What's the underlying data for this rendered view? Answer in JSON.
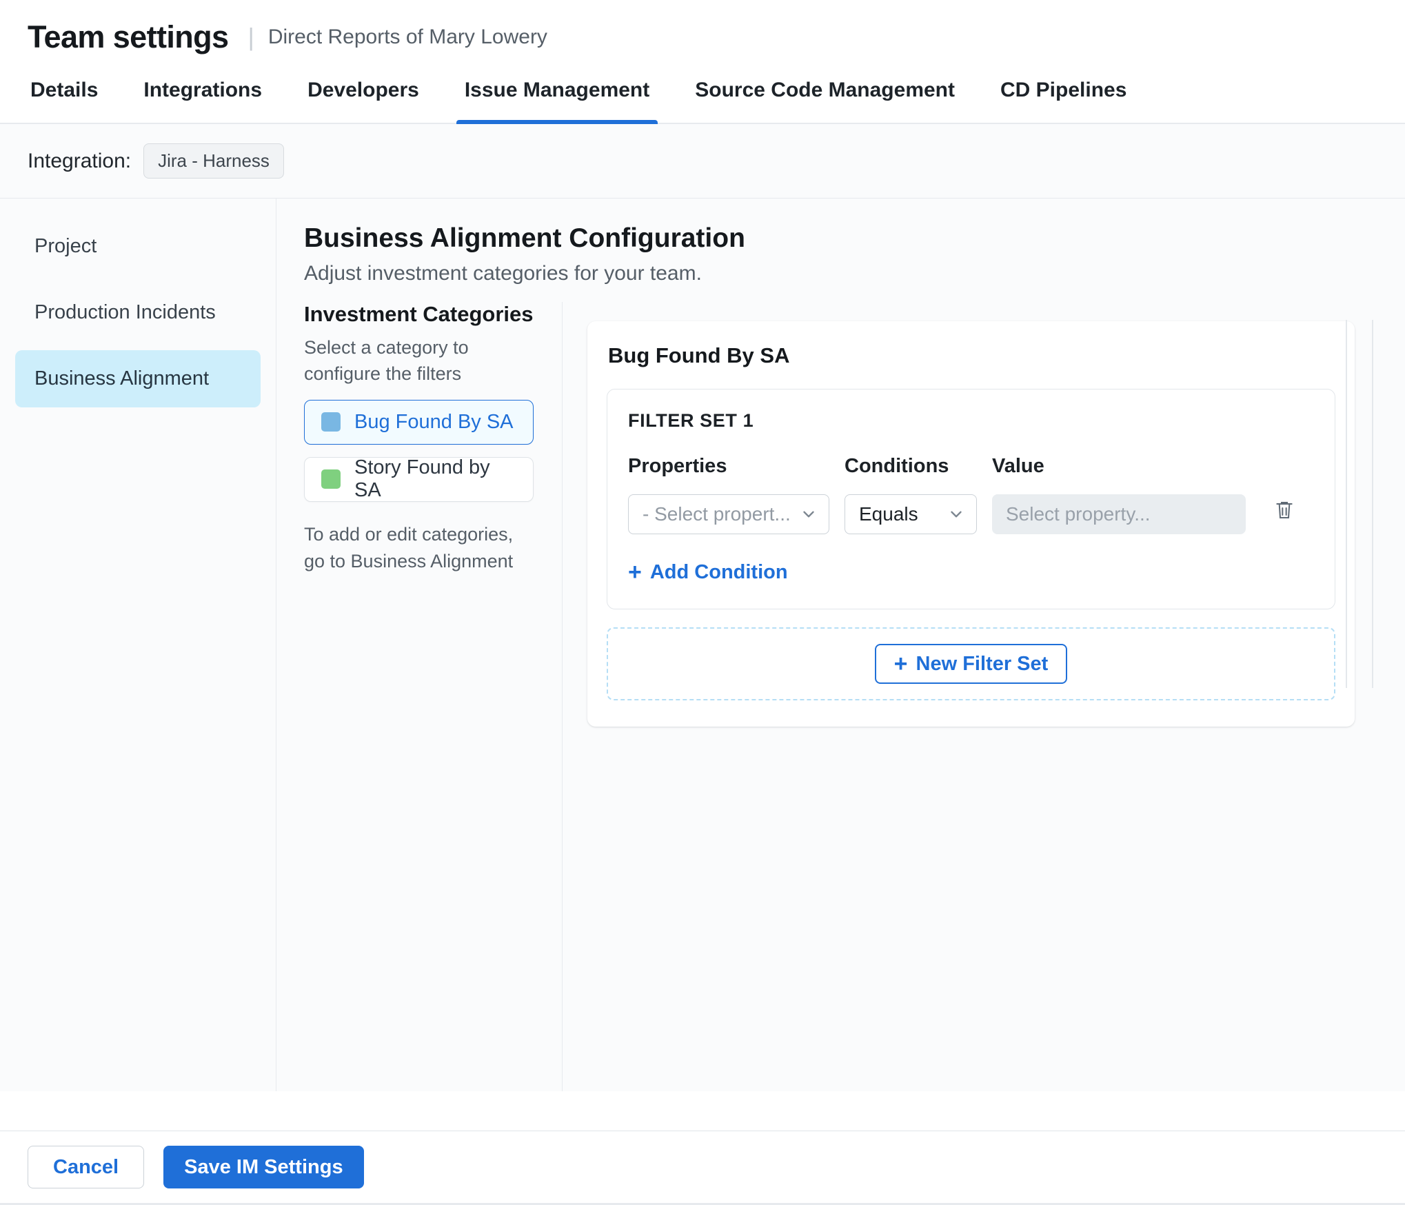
{
  "header": {
    "title": "Team settings",
    "separator": "|",
    "subtitle": "Direct Reports of Mary Lowery"
  },
  "tabs": [
    {
      "label": "Details",
      "active": false
    },
    {
      "label": "Integrations",
      "active": false
    },
    {
      "label": "Developers",
      "active": false
    },
    {
      "label": "Issue Management",
      "active": true
    },
    {
      "label": "Source Code Management",
      "active": false
    },
    {
      "label": "CD Pipelines",
      "active": false
    }
  ],
  "integration": {
    "label": "Integration:",
    "value": "Jira - Harness"
  },
  "sidebar": {
    "items": [
      {
        "label": "Project",
        "selected": false
      },
      {
        "label": "Production Incidents",
        "selected": false
      },
      {
        "label": "Business Alignment",
        "selected": true
      }
    ]
  },
  "main": {
    "title": "Business Alignment Configuration",
    "subtitle": "Adjust investment categories for your team.",
    "categories": {
      "heading": "Investment Categories",
      "description": "Select a category to configure the filters",
      "items": [
        {
          "label": "Bug Found By SA",
          "swatch_color": "#79b7e3",
          "selected": true
        },
        {
          "label": "Story Found by SA",
          "swatch_color": "#7fd07f",
          "selected": false
        }
      ],
      "note": "To add or edit categories, go to Business Alignment"
    },
    "panel": {
      "title": "Bug Found By SA",
      "filter_set": {
        "heading": "FILTER SET 1",
        "properties_label": "Properties",
        "conditions_label": "Conditions",
        "value_label": "Value",
        "property_placeholder": "- Select propert...",
        "condition_selected": "Equals",
        "value_placeholder": "Select property...",
        "add_condition_label": "Add Condition"
      },
      "new_filter_set_label": "New Filter Set"
    }
  },
  "footer": {
    "cancel_label": "Cancel",
    "save_label": "Save IM Settings"
  },
  "icons": {
    "plus": "+"
  },
  "colors": {
    "primary": "#1f6fd8",
    "sidebar_selected_bg": "#cdeefb",
    "category_selected_bg": "#f2fbff",
    "bug_swatch": "#79b7e3",
    "story_swatch": "#7fd07f"
  }
}
